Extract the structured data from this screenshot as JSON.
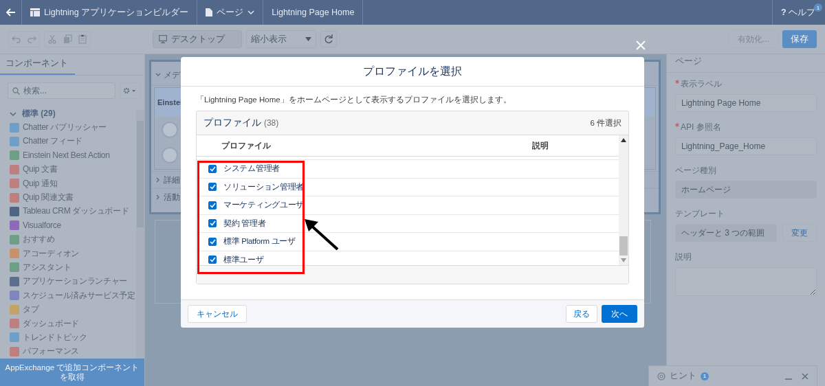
{
  "top_bar": {
    "app_name": "Lightning アプリケーションビルダー",
    "page_menu": "ページ",
    "page_name": "Lightning Page Home",
    "help_icon": "?",
    "help": "ヘルプ",
    "help_badge": "1"
  },
  "toolbar": {
    "device": "デスクトップ",
    "zoom": "縮小表示",
    "activate": "有効化...",
    "save": "保存"
  },
  "left_panel": {
    "tab": "コンポーネント",
    "search_placeholder": "検索...",
    "group": {
      "label": "標準 (29)",
      "expanded": true
    },
    "components": [
      {
        "label": "Chatter パブリッシャー",
        "color": "#6f9fc8"
      },
      {
        "label": "Chatter フィード",
        "color": "#6f9fc8"
      },
      {
        "label": "Einstein Next Best Action",
        "color": "#6e9f86"
      },
      {
        "label": "Quip 文書",
        "color": "#c07f7f"
      },
      {
        "label": "Quip 通知",
        "color": "#c07f7f"
      },
      {
        "label": "Quip 関連文書",
        "color": "#c07f7f"
      },
      {
        "label": "Tableau CRM ダッシュボード",
        "color": "#4f6584"
      },
      {
        "label": "Visualforce",
        "color": "#8c69b9"
      },
      {
        "label": "おすすめ",
        "color": "#6e9f86"
      },
      {
        "label": "アコーディオン",
        "color": "#c79169"
      },
      {
        "label": "アシスタント",
        "color": "#6e9f86"
      },
      {
        "label": "アプリケーションランチャー",
        "color": "#5c6f8c"
      },
      {
        "label": "スケジュール済みサービス予定",
        "color": "#7f86bd"
      },
      {
        "label": "タブ",
        "color": "#c4a466"
      },
      {
        "label": "ダッシュボード",
        "color": "#c07f7f"
      },
      {
        "label": "トレンドトピック",
        "color": "#6f9fc8"
      },
      {
        "label": "パフォーマンス",
        "color": "#c07f7f"
      }
    ],
    "appexchange": "AppExchange で追加コンポーネントを取得"
  },
  "canvas": {
    "section": "メデ",
    "card_title": "Einstei",
    "sections": [
      "詳細",
      "活動"
    ]
  },
  "right_panel": {
    "title": "ページ",
    "fields": [
      {
        "kind": "input",
        "label": "表示ラベル",
        "required": true,
        "value": "Lightning Page Home"
      },
      {
        "kind": "input",
        "label": "API 参照名",
        "required": true,
        "value": "Lightning_Page_Home"
      },
      {
        "kind": "readonly",
        "label": "ページ種別",
        "required": false,
        "value": "ホームページ"
      },
      {
        "kind": "template",
        "label": "テンプレート",
        "required": false,
        "value": "ヘッダーと 3 つの範囲",
        "button": "変更"
      },
      {
        "kind": "textarea",
        "label": "説明",
        "required": false
      }
    ]
  },
  "hint_bar": {
    "label": "ヒント",
    "badge": "1"
  },
  "modal": {
    "title": "プロファイルを選択",
    "description": "「Lightning Page Home」をホームページとして表示するプロファイルを選択します。",
    "card_title": "プロファイル",
    "count": "(38)",
    "selected_count": "6 件選択",
    "columns": [
      "プロファイル",
      "説明"
    ],
    "rows": [
      {
        "name": "システム管理者",
        "checked": true
      },
      {
        "name": "ソリューション管理者",
        "checked": true
      },
      {
        "name": "マーケティングユーザ",
        "checked": true
      },
      {
        "name": "契約 管理者",
        "checked": true
      },
      {
        "name": "標準 Platform ユーザ",
        "checked": true
      },
      {
        "name": "標準ユーザ",
        "checked": true
      }
    ],
    "cancel": "キャンセル",
    "back": "戻る",
    "next": "次へ"
  }
}
